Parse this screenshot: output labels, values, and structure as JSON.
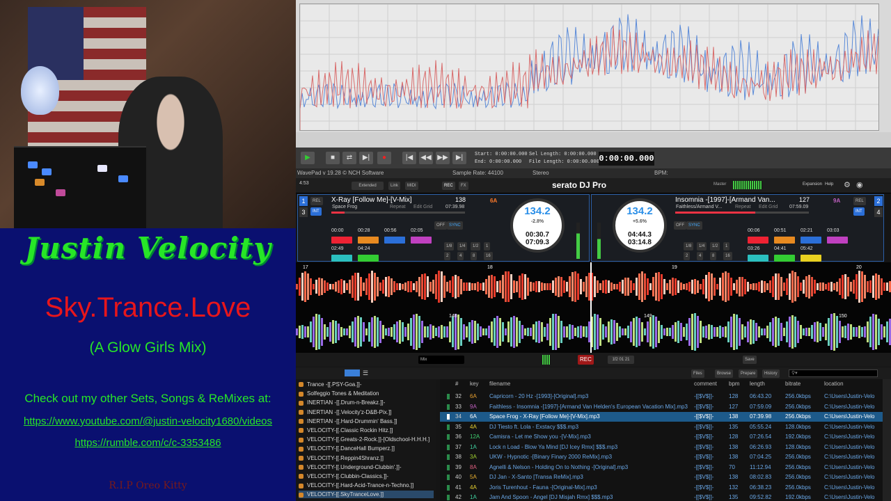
{
  "overlay": {
    "name": "Justin Velocity",
    "subtitle": "Sky.Trance.Love",
    "mix": "(A Glow Girls Mix)",
    "check": "Check out my other Sets, Songs & ReMixes at:",
    "link1": "https://www.youtube.com/@justin-velocity1680/videos",
    "link2": "https://rumble.com/c/c-3353486",
    "rip": "R.I.P Oreo Kitty",
    "colors": {
      "green": "#27e627",
      "red": "#e8161b",
      "bg": "#0a1070"
    }
  },
  "wavepad": {
    "start_label": "Start:",
    "start_val": "0:00:00.000",
    "end_label": "End:",
    "end_val": "0:00:00.000",
    "sel_label": "Sel Length:",
    "sel_val": "0:00:00.000",
    "file_label": "File Length:",
    "file_val": "0:00:00.000",
    "time": "0:00:00.000",
    "app": "WavePad v 19.28 © NCH Software",
    "rate": "Sample Rate: 44100",
    "channels": "Stereo",
    "bpm": "BPM:"
  },
  "serato": {
    "clock": "4:53",
    "mode": "Extended",
    "link": "Link",
    "midi": "MIDI",
    "rec": "REC",
    "fx": "FX",
    "logo": "serato DJ Pro",
    "master": "Master",
    "expansion": "Expansion",
    "help": "Help",
    "deck1": {
      "num": "1",
      "title": "X-Ray [Follow Me]-[V-Mix]",
      "artist": "Space Frog",
      "bpm": "138",
      "key": "6A",
      "remain": "07:39.98",
      "mode": "REL",
      "int": "INT",
      "sync": "SYNC",
      "off": "OFF",
      "repeat": "Repeat",
      "editgrid": "Edit Grid",
      "pbpm": "134.2",
      "pitch": "-2.8%",
      "range": "±8",
      "elapsed": "00:30.7",
      "left": "07:09.3",
      "cues": [
        "00:00",
        "00:28",
        "00:56",
        "02:05",
        "02:49",
        "04:24"
      ],
      "loops": [
        "1/8",
        "1/4",
        "1/2",
        "1",
        "2",
        "4",
        "8",
        "16"
      ]
    },
    "deck2": {
      "num": "2",
      "title": "Insomnia -[1997]-[Armand Van...",
      "artist": "Faithless/Armand V...",
      "bpm": "127",
      "key": "9A",
      "remain": "07:59.09",
      "mode": "REL",
      "int": "INT",
      "sync": "SYNC",
      "off": "OFF",
      "repeat": "Repeat",
      "editgrid": "Edit Grid",
      "pbpm": "134.2",
      "pitch": "+5.6%",
      "range": "±8",
      "elapsed": "04:44.3",
      "left": "03:14.8",
      "cues": [
        "00:06",
        "00:51",
        "02:21",
        "03:03",
        "03:26",
        "04:41",
        "05:42"
      ],
      "loops": [
        "1/8",
        "1/4",
        "1/2",
        "1",
        "2",
        "4",
        "8",
        "16"
      ]
    },
    "deck_side_nums": [
      "3",
      "4"
    ],
    "beats": [
      "17",
      "18",
      "19",
      "20",
      "148",
      "149",
      "150"
    ],
    "mix": "Mix",
    "time": "1f2 01 21",
    "save": "Save",
    "lib_tabs": [
      "Files",
      "Browse",
      "Prepare",
      "History"
    ],
    "crates": [
      "Trance -[[.PSY-Goa.]]-",
      "Solfeggio Tones & Meditation",
      "INERTIAN -[[.Drum-n-Breakz.]]-",
      "INERTIAN -[[.Velocity'z-D&B-Pix.]]",
      "INERTIAN -[[.Hard-Drummin' Bass.]]",
      "VELOCITY-[[.Classic Rockin Hitz.]]",
      "VELOCITY-[[.Greats-2-Rock.]]-[Oldschool-H.H.H.]",
      "VELOCITY-[[.DanceHall Bumperz.]]",
      "VELOCITY-[[.Reppin4Shranz.]]",
      "VELOCITY-[[.Underground-Clubbin'.]]-",
      "VELOCITY-[[.Clubbin-Classics.]]-",
      "VELOCITY-[[.Hard-Acid-Trance-n-Techno.]]",
      "VELOCITY-[[.SkyTranceLove.]]"
    ],
    "columns": [
      "#",
      "key",
      "filename",
      "comment",
      "bpm",
      "length",
      "bitrate",
      "location"
    ],
    "tracks": [
      {
        "n": "32",
        "k": "6A",
        "f": "Capricorn - 20 Hz -[1993]-[Original].mp3",
        "c": "-[[$V$]]-",
        "b": "128",
        "l": "06:43.20",
        "r": "256.0kbps",
        "p": "C:\\Users\\Justin-Velo",
        "kc": "#e8a030"
      },
      {
        "n": "33",
        "k": "9A",
        "f": "Faithless - Insomnia -[1997]-[Armand Van Helden's European Vacation Mix].mp3",
        "c": "-[[$V$]]-",
        "b": "127",
        "l": "07:59.09",
        "r": "256.0kbps",
        "p": "C:\\Users\\Justin-Velo",
        "kc": "#c060c0"
      },
      {
        "n": "34",
        "k": "6A",
        "f": "Space Frog - X-Ray [Follow Me]-[V-Mix].mp3",
        "c": "-[[$V$]]-",
        "b": "138",
        "l": "07:39.98",
        "r": "256.0kbps",
        "p": "C:\\Users\\Justin-Velo",
        "kc": "#ff9040",
        "sel": true
      },
      {
        "n": "35",
        "k": "4A",
        "f": "DJ Tiesto ft. Lola - Exstacy $$$.mp3",
        "c": "-[[$V$]]-",
        "b": "135",
        "l": "05:55.24",
        "r": "128.0kbps",
        "p": "C:\\Users\\Justin-Velo",
        "kc": "#e8d030"
      },
      {
        "n": "36",
        "k": "12A",
        "f": "Camisra - Let me Show you -[V-Mix].mp3",
        "c": "-[[$V$]]-",
        "b": "128",
        "l": "07:26.54",
        "r": "192.0kbps",
        "p": "C:\\Users\\Justin-Velo",
        "kc": "#40d070"
      },
      {
        "n": "37",
        "k": "1A",
        "f": "Lock n Load - Blow Ya Mind [DJ Icey Rmx] $$$.mp3",
        "c": "-[[$V$]]-",
        "b": "138",
        "l": "06:26.93",
        "r": "128.0kbps",
        "p": "C:\\Users\\Justin-Velo",
        "kc": "#40d0a0"
      },
      {
        "n": "38",
        "k": "3A",
        "f": "UKW - Hypnotic -[Binary Finary 2000 ReMix].mp3",
        "c": "-[[$V$]]-",
        "b": "138",
        "l": "07:04.25",
        "r": "256.0kbps",
        "p": "C:\\Users\\Justin-Velo",
        "kc": "#a0d030"
      },
      {
        "n": "39",
        "k": "8A",
        "f": "Agnelli & Nelson - Holding On to Nothing -[Original].mp3",
        "c": "-[[$V$]]-",
        "b": "70",
        "l": "11:12.94",
        "r": "256.0kbps",
        "p": "C:\\Users\\Justin-Velo",
        "kc": "#e06080"
      },
      {
        "n": "40",
        "k": "5A",
        "f": "DJ Jan - X-Santo [Transa ReMix].mp3",
        "c": "-[[$V$]]-",
        "b": "138",
        "l": "08:02.83",
        "r": "256.0kbps",
        "p": "C:\\Users\\Justin-Velo",
        "kc": "#e8b030"
      },
      {
        "n": "41",
        "k": "4A",
        "f": "Joris Turenhout - Fauna -[Original-Mix].mp3",
        "c": "-[[$V$]]-",
        "b": "132",
        "l": "06:38.23",
        "r": "256.0kbps",
        "p": "C:\\Users\\Justin-Velo",
        "kc": "#e8d030"
      },
      {
        "n": "42",
        "k": "1A",
        "f": "Jam And Spoon - Angel [DJ Misjah Rmx] $$$.mp3",
        "c": "-[[$V$]]-",
        "b": "135",
        "l": "09:52.82",
        "r": "192.0kbps",
        "p": "C:\\Users\\Justin-Velo",
        "kc": "#40d0a0"
      }
    ]
  }
}
